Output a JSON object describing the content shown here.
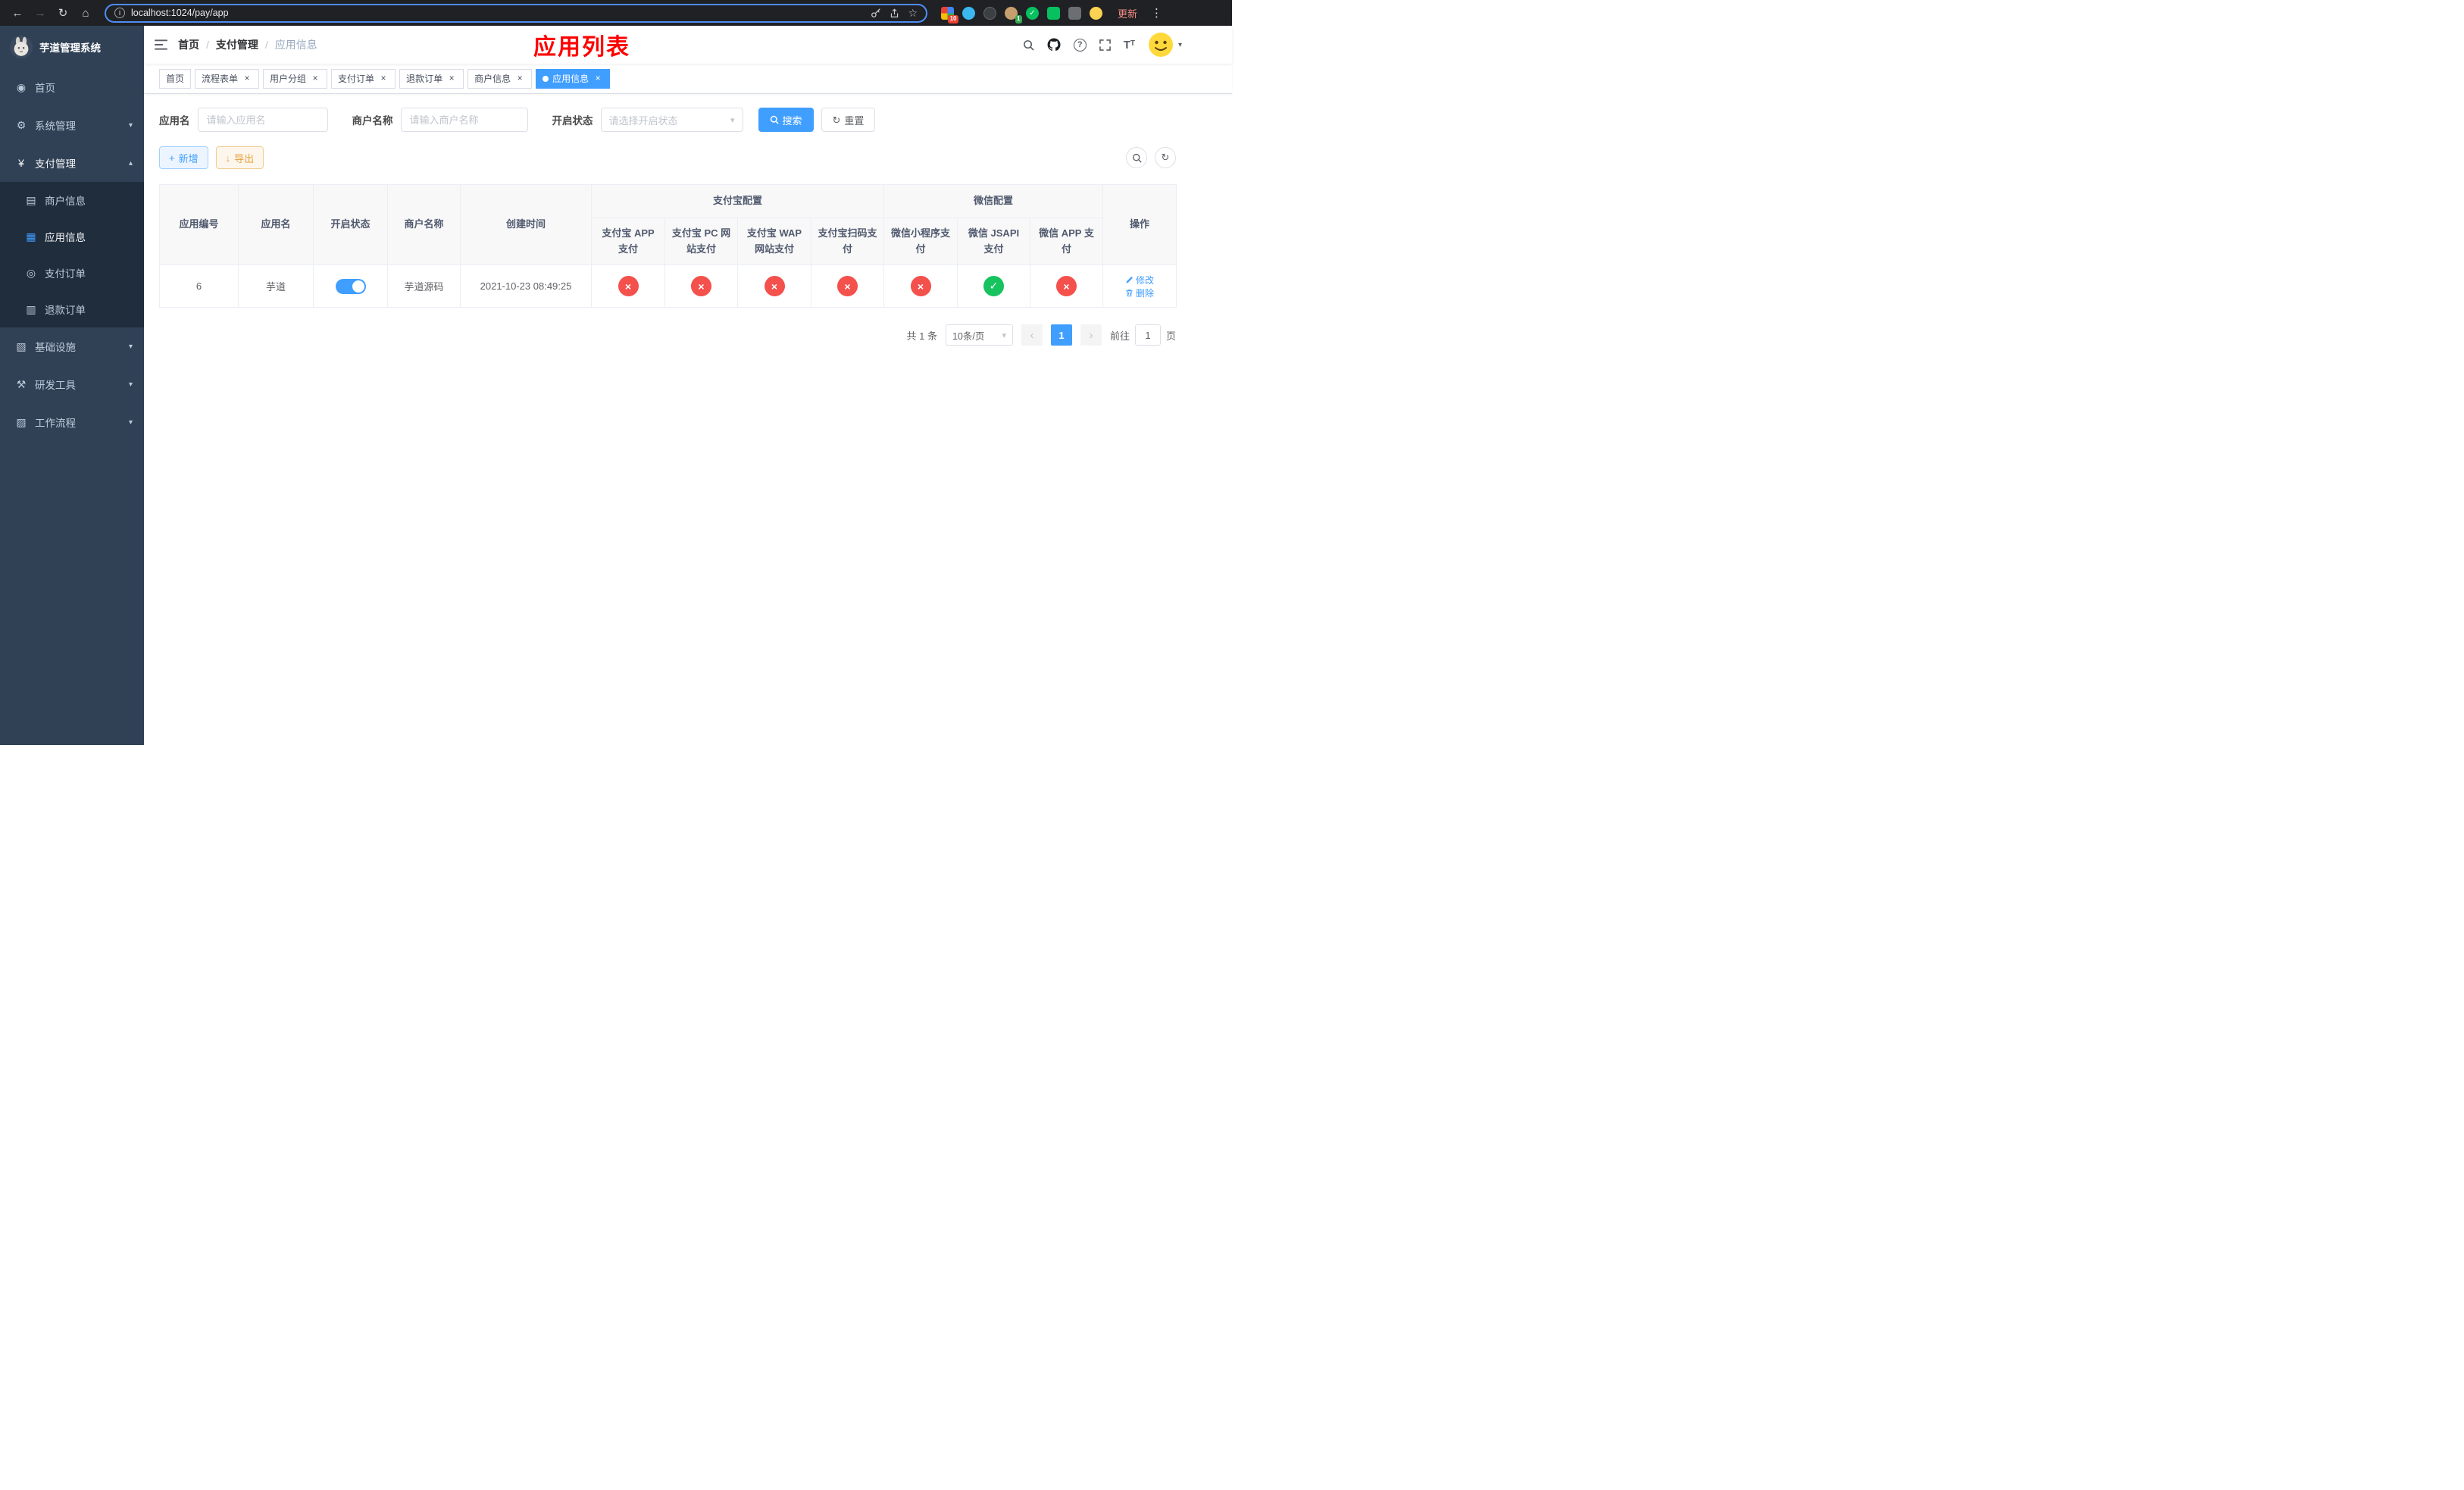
{
  "colors": {
    "accent": "#409eff",
    "danger": "#f4504c",
    "success": "#17c35f",
    "annotation": "#fe0100"
  },
  "browser": {
    "url": "localhost:1024/pay/app",
    "update_label": "更新",
    "badges": {
      "extensions_grid": "10",
      "extension_avatar": "1"
    }
  },
  "sidebar": {
    "title": "芋道管理系统",
    "menu": [
      {
        "label": "首页"
      },
      {
        "label": "系统管理"
      },
      {
        "label": "支付管理"
      },
      {
        "label": "商户信息"
      },
      {
        "label": "应用信息"
      },
      {
        "label": "支付订单"
      },
      {
        "label": "退款订单"
      },
      {
        "label": "基础设施"
      },
      {
        "label": "研发工具"
      },
      {
        "label": "工作流程"
      }
    ]
  },
  "header": {
    "breadcrumb": [
      "首页",
      "支付管理",
      "应用信息"
    ],
    "annotation": "应用列表"
  },
  "tabs": [
    {
      "label": "首页",
      "closable": false,
      "active": false
    },
    {
      "label": "流程表单",
      "closable": true,
      "active": false
    },
    {
      "label": "用户分组",
      "closable": true,
      "active": false
    },
    {
      "label": "支付订单",
      "closable": true,
      "active": false
    },
    {
      "label": "退款订单",
      "closable": true,
      "active": false
    },
    {
      "label": "商户信息",
      "closable": true,
      "active": false
    },
    {
      "label": "应用信息",
      "closable": true,
      "active": true
    }
  ],
  "filter": {
    "app_name_label": "应用名",
    "app_name_placeholder": "请输入应用名",
    "merchant_label": "商户名称",
    "merchant_placeholder": "请输入商户名称",
    "status_label": "开启状态",
    "status_placeholder": "请选择开启状态",
    "search_label": "搜索",
    "reset_label": "重置"
  },
  "toolbar": {
    "add_label": "新增",
    "export_label": "导出"
  },
  "table": {
    "columns_simple": [
      "应用编号",
      "应用名",
      "开启状态",
      "商户名称",
      "创建时间"
    ],
    "groups": [
      {
        "label": "支付宝配置",
        "subs": [
          "支付宝 APP 支付",
          "支付宝 PC 网站支付",
          "支付宝 WAP 网站支付",
          "支付宝扫码支付"
        ]
      },
      {
        "label": "微信配置",
        "subs": [
          "微信小程序支付",
          "微信 JSAPI 支付",
          "微信 APP 支付"
        ]
      }
    ],
    "actions_label": "操作",
    "row": {
      "id": "6",
      "name": "芋道",
      "enabled": true,
      "merchant": "芋道源码",
      "created": "2021-10-23 08:49:25",
      "statuses": [
        "no",
        "no",
        "no",
        "no",
        "no",
        "yes",
        "no"
      ],
      "edit_label": "修改",
      "delete_label": "删除"
    }
  },
  "pagination": {
    "total": "共 1 条",
    "page_size": "10条/页",
    "current": "1",
    "goto_label": "前往",
    "goto_value": "1",
    "page_unit": "页"
  }
}
